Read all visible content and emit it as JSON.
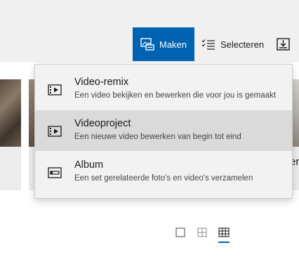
{
  "toolbar": {
    "maken_label": "Maken",
    "selecteren_label": "Selecteren",
    "accent_color": "#0063b1"
  },
  "menu": {
    "items": [
      {
        "title": "Video-remix",
        "description": "Een video bekijken en bewerken die voor jou is gemaakt",
        "icon": "film-icon"
      },
      {
        "title": "Videoproject",
        "description": "Een nieuwe video bewerken van begin tot eind",
        "icon": "film-icon",
        "highlighted": true
      },
      {
        "title": "Album",
        "description": "Een set gerelateerde foto's en video's verzamelen",
        "icon": "album-icon"
      }
    ]
  },
  "gallery": {
    "peek_text": "er"
  },
  "view_options": {
    "items": [
      "single-view-icon",
      "medium-grid-icon",
      "small-grid-icon"
    ],
    "selected": "small-grid-icon"
  }
}
